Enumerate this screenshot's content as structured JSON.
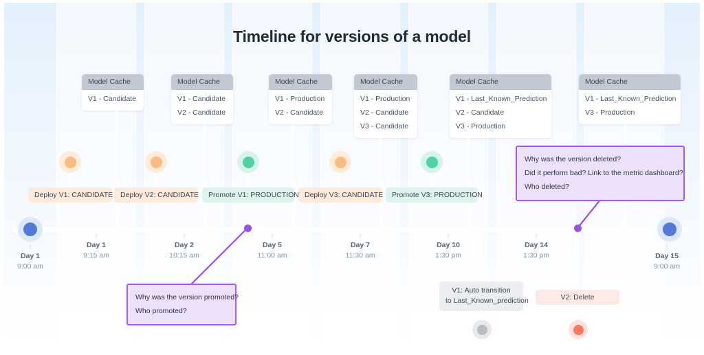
{
  "title": "Timeline for versions of a model",
  "colors": {
    "accent_blue": "#5479d8",
    "orange": "#fbbc83",
    "green": "#4fd1a8",
    "grey": "#b9bdc2",
    "red": "#f97a5c",
    "purple": "#9b4fe8",
    "note_bg": "#ece0fa",
    "cache_header": "#c3c9d2"
  },
  "cache_header_label": "Model Cache",
  "caches": [
    {
      "header": "Model Cache",
      "rows": [
        "V1 - Candidate"
      ]
    },
    {
      "header": "Model Cache",
      "rows": [
        "V1 - Candidate",
        "V2 - Candidate"
      ]
    },
    {
      "header": "Model Cache",
      "rows": [
        "V1 - Production",
        "V2 - Candidate"
      ]
    },
    {
      "header": "Model Cache",
      "rows": [
        "V1 - Production",
        "V2 - Candidate",
        "V3 - Candidate"
      ]
    },
    {
      "header": "Model Cache",
      "rows": [
        "V1 - Last_Known_Prediction",
        "V2 - Candidate",
        "V3 - Production"
      ]
    },
    {
      "header": "Model Cache",
      "rows": [
        "V1 - Last_Known_Prediction",
        "V3 - Production"
      ]
    }
  ],
  "events": [
    {
      "label": "Deploy V1: CANDIDATE",
      "color": "orange"
    },
    {
      "label": "Deploy V2: CANDIDATE",
      "color": "orange"
    },
    {
      "label": "Promote V1: PRODUCTION",
      "color": "green"
    },
    {
      "label": "Deploy V3: CANDIDATE",
      "color": "orange"
    },
    {
      "label": "Promote V3: PRODUCTION",
      "color": "green"
    }
  ],
  "below_events": [
    {
      "label_line1": "V1: Auto transition",
      "label_line2": "to Last_Known_prediction",
      "color": "grey"
    },
    {
      "label_line1": "V2: Delete",
      "label_line2": "",
      "color": "red"
    }
  ],
  "ticks": [
    {
      "day": "Day 1",
      "time": "9:00 am",
      "arrow": "↑"
    },
    {
      "day": "Day 1",
      "time": "9:15 am",
      "arrow": "↑"
    },
    {
      "day": "Day 2",
      "time": "10:15 am",
      "arrow": "↑"
    },
    {
      "day": "Day 5",
      "time": "11:00 am",
      "arrow": "↑"
    },
    {
      "day": "Day 7",
      "time": "11:30 am",
      "arrow": "↑"
    },
    {
      "day": "Day 10",
      "time": "1:30 pm",
      "arrow": "↑"
    },
    {
      "day": "Day 14",
      "time": "1:30 pm",
      "arrow": "↑"
    },
    {
      "day": "Day 15",
      "time": "9:00 am",
      "arrow": "↑"
    }
  ],
  "notes": [
    {
      "id": "promoted-note",
      "lines": [
        "Why was the version promoted?",
        "Who promoted?"
      ]
    },
    {
      "id": "deleted-note",
      "lines": [
        "Why was the version deleted?",
        "Did it perform bad? Link to the metric dashboard?",
        "Who deleted?"
      ]
    }
  ]
}
